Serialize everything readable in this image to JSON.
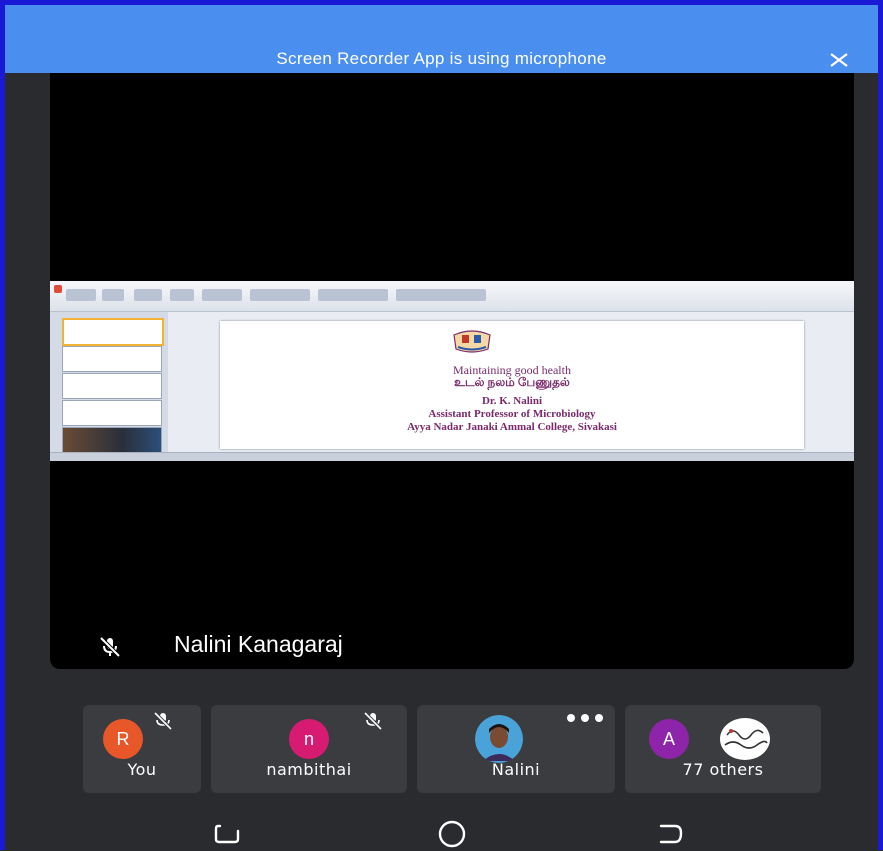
{
  "banner": {
    "text": "Screen Recorder App is using microphone",
    "close_icon": "close-icon",
    "color": "#4a8ef0"
  },
  "presenter": {
    "name": "Nalini Kanagaraj",
    "mic_icon": "mic-off-icon"
  },
  "shared_slide": {
    "title": "Maintaining good health",
    "tamil_title": "உடல் நலம் பேணுதல்",
    "line1": "Dr. K. Nalini",
    "line2": "Assistant Professor of Microbiology",
    "line3": "Ayya Nadar Janaki Ammal College, Sivakasi",
    "text_color": "#7a2a6b"
  },
  "participants": [
    {
      "label": "You",
      "avatar_letter": "R",
      "avatar_color": "#e8572a",
      "mic_icon": "mic-off-icon"
    },
    {
      "label": "nambithai",
      "avatar_letter": "n",
      "avatar_color": "#d81b72",
      "mic_icon": "mic-off-icon"
    },
    {
      "label": "Nalini",
      "avatar": "user-photo",
      "more_icon": "more-options-icon"
    },
    {
      "label": "77 others",
      "avatar_letter": "A",
      "avatar_color": "#8e24aa",
      "second_avatar": "handwritten-avatar"
    }
  ],
  "nav": {
    "recents_icon": "recents-icon",
    "home_icon": "home-icon",
    "back_icon": "back-icon"
  }
}
